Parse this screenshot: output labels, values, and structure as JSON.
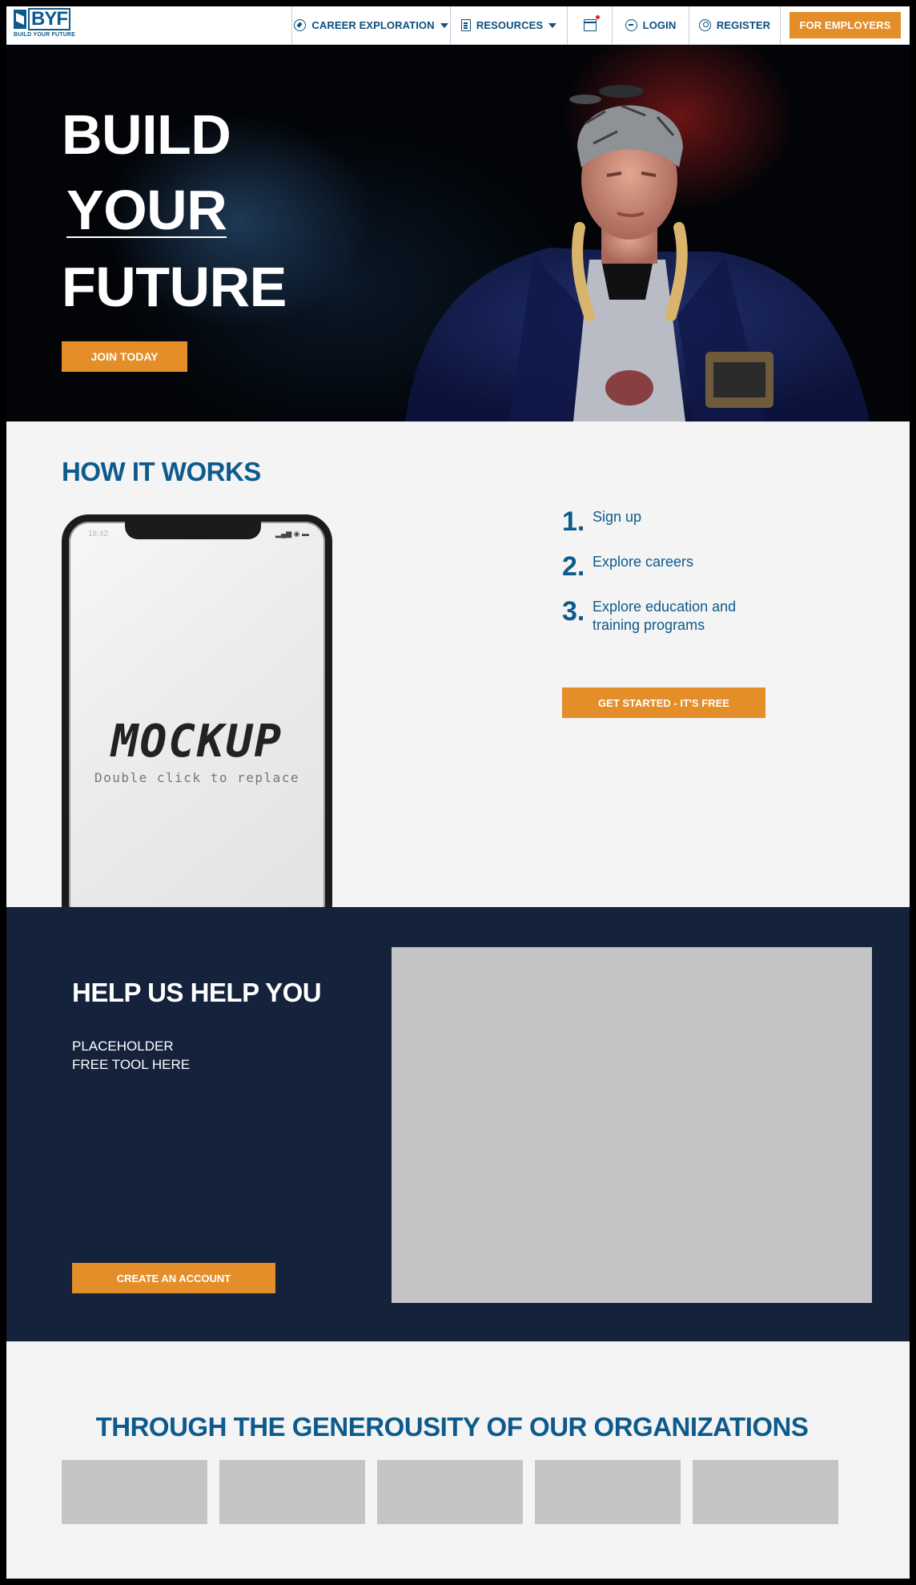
{
  "brand": {
    "logo_text": "BYF",
    "tagline": "BUILD YOUR FUTURE",
    "accent": "#e38e29",
    "primary": "#0d5a8c",
    "navy": "#14223c"
  },
  "nav": {
    "items": [
      {
        "label": "CAREER EXPLORATION",
        "icon": "compass-icon",
        "dropdown": true
      },
      {
        "label": "RESOURCES",
        "icon": "document-icon",
        "dropdown": true
      },
      {
        "label": "",
        "icon": "calendar-icon",
        "dropdown": false
      },
      {
        "label": "LOGIN",
        "icon": "login-icon",
        "dropdown": false
      },
      {
        "label": "REGISTER",
        "icon": "user-icon",
        "dropdown": false
      }
    ],
    "employers_button": "FOR EMPLOYERS"
  },
  "hero": {
    "title_lines": [
      "BUILD",
      "YOUR",
      "FUTURE"
    ],
    "cta": "JOIN TODAY"
  },
  "how_it_works": {
    "title": "HOW IT WORKS",
    "phone": {
      "time": "18:42",
      "mockup_title": "MOCKUP",
      "mockup_subtitle": "Double click to replace"
    },
    "steps": [
      {
        "num": "1.",
        "text": "Sign up"
      },
      {
        "num": "2.",
        "text": "Explore careers"
      },
      {
        "num": "3.",
        "text": "Explore education and training programs"
      }
    ],
    "cta": "GET STARTED - IT'S FREE"
  },
  "help": {
    "title": "HELP US HELP YOU",
    "text_lines": [
      "PLACEHOLDER",
      "FREE TOOL HERE"
    ],
    "cta": "CREATE AN ACCOUNT"
  },
  "sponsors": {
    "title": "THROUGH THE GENEROUSITY OF OUR ORGANIZATIONS",
    "logo_count": 5
  }
}
